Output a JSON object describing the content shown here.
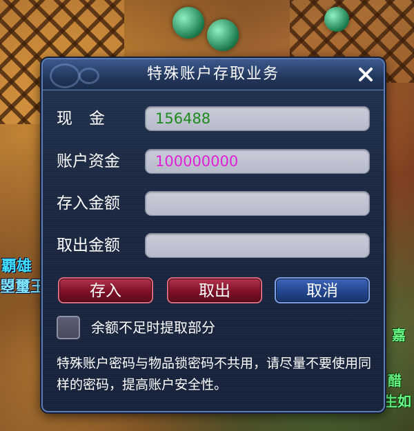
{
  "background": {
    "left_chars": [
      "覇雄",
      "曌璽玉"
    ],
    "right_chars": [
      "嘉",
      "醋",
      "生如"
    ]
  },
  "dialog": {
    "title": "特殊账户存取业务",
    "close_icon": "close-x-icon",
    "fields": {
      "cash": {
        "label": "现金",
        "value": "156488",
        "color": "#1c8a1c"
      },
      "account_funds": {
        "label": "账户资金",
        "value": "100000000",
        "color": "#e020d8"
      },
      "deposit_amount": {
        "label": "存入金额",
        "value": "",
        "placeholder": ""
      },
      "withdraw_amount": {
        "label": "取出金额",
        "value": "",
        "placeholder": ""
      }
    },
    "buttons": {
      "deposit": "存入",
      "withdraw": "取出",
      "cancel": "取消"
    },
    "checkbox": {
      "label": "余额不足时提取部分",
      "checked": false
    },
    "notice": "特殊账户密码与物品锁密码不共用，请尽量不要使用同样的密码，提高账户安全性。"
  }
}
